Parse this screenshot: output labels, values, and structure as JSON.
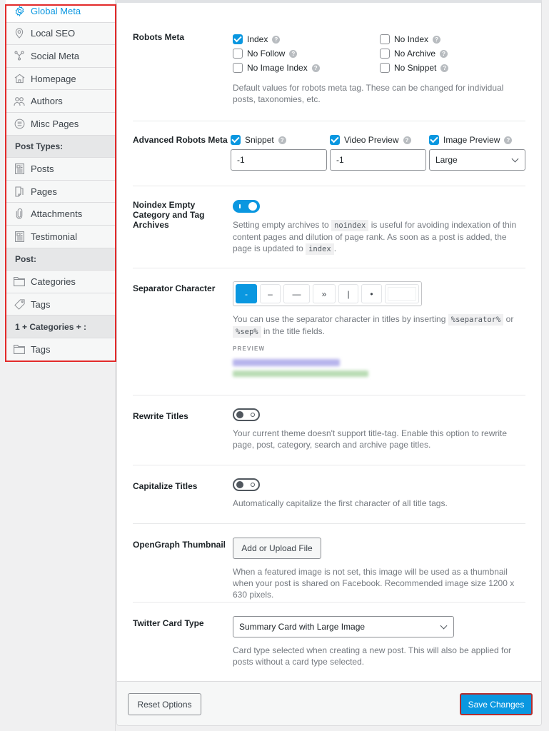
{
  "sidebar": {
    "items": [
      {
        "label": "Global Meta",
        "icon": "gear-icon",
        "active": true
      },
      {
        "label": "Local SEO",
        "icon": "location-pin-icon"
      },
      {
        "label": "Social Meta",
        "icon": "share-icon"
      },
      {
        "label": "Homepage",
        "icon": "home-icon"
      },
      {
        "label": "Authors",
        "icon": "users-icon"
      },
      {
        "label": "Misc Pages",
        "icon": "list-circle-icon"
      }
    ],
    "group_post_types": "Post Types:",
    "post_types": [
      {
        "label": "Posts",
        "icon": "post-icon"
      },
      {
        "label": "Pages",
        "icon": "page-icon"
      },
      {
        "label": "Attachments",
        "icon": "paperclip-icon"
      },
      {
        "label": "Testimonial",
        "icon": "post-icon"
      }
    ],
    "group_post": "Post:",
    "post_taxonomies": [
      {
        "label": "Categories",
        "icon": "folder-icon"
      },
      {
        "label": "Tags",
        "icon": "tag-icon"
      }
    ],
    "group_custom": "1 + Categories + :",
    "custom_taxonomies": [
      {
        "label": "Tags",
        "icon": "folder-icon"
      }
    ]
  },
  "robots_meta": {
    "label": "Robots Meta",
    "options": [
      {
        "label": "Index",
        "checked": true
      },
      {
        "label": "No Index",
        "checked": false
      },
      {
        "label": "No Follow",
        "checked": false
      },
      {
        "label": "No Archive",
        "checked": false
      },
      {
        "label": "No Image Index",
        "checked": false
      },
      {
        "label": "No Snippet",
        "checked": false
      }
    ],
    "description": "Default values for robots meta tag. These can be changed for individual posts, taxonomies, etc."
  },
  "advanced_robots": {
    "label": "Advanced Robots Meta",
    "snippet": {
      "label": "Snippet",
      "checked": true,
      "value": "-1"
    },
    "video_preview": {
      "label": "Video Preview",
      "checked": true,
      "value": "-1"
    },
    "image_preview": {
      "label": "Image Preview",
      "checked": true,
      "value": "Large"
    }
  },
  "noindex_empty": {
    "label": "Noindex Empty Category and Tag Archives",
    "enabled": true,
    "desc_1": "Setting empty archives to",
    "code_1": "noindex",
    "desc_2": "is useful for avoiding indexation of thin content pages and dilution of page rank. As soon as a post is added, the page is updated to",
    "code_2": "index",
    "desc_3": "."
  },
  "separator": {
    "label": "Separator Character",
    "options": [
      "-",
      "–",
      "—",
      "»",
      "|",
      "•"
    ],
    "selected": "-",
    "custom_value": "",
    "desc_1": "You can use the separator character in titles by inserting",
    "code_1": "%separator%",
    "desc_2": "or",
    "code_2": "%sep%",
    "desc_3": "in the title fields.",
    "preview_label": "PREVIEW"
  },
  "rewrite_titles": {
    "label": "Rewrite Titles",
    "enabled": false,
    "description": "Your current theme doesn't support title-tag. Enable this option to rewrite page, post, category, search and archive page titles."
  },
  "capitalize_titles": {
    "label": "Capitalize Titles",
    "enabled": false,
    "description": "Automatically capitalize the first character of all title tags."
  },
  "opengraph": {
    "label": "OpenGraph Thumbnail",
    "button": "Add or Upload File",
    "description": "When a featured image is not set, this image will be used as a thumbnail when your post is shared on Facebook. Recommended image size 1200 x 630 pixels."
  },
  "twitter_card": {
    "label": "Twitter Card Type",
    "value": "Summary Card with Large Image",
    "description": "Card type selected when creating a new post. This will also be applied for posts without a card type selected."
  },
  "footer": {
    "reset_label": "Reset Options",
    "save_label": "Save Changes"
  },
  "colors": {
    "accent": "#0a97e0",
    "highlight_border": "#e32a2a"
  }
}
